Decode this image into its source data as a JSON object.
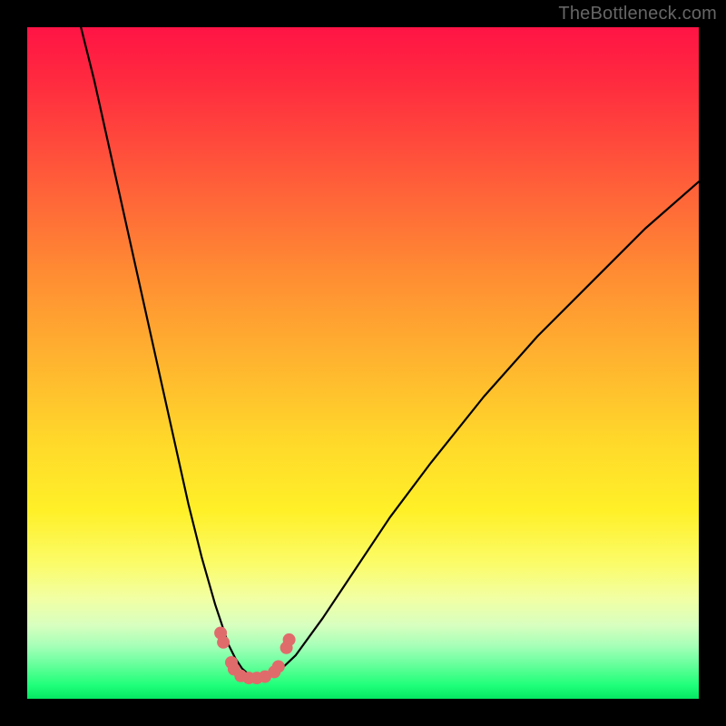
{
  "watermark": "TheBottleneck.com",
  "chart_data": {
    "type": "line",
    "title": "",
    "xlabel": "",
    "ylabel": "",
    "xlim": [
      0,
      100
    ],
    "ylim": [
      0,
      100
    ],
    "grid": false,
    "legend": false,
    "series": [
      {
        "name": "bottleneck-curve",
        "x": [
          8,
          10,
          12,
          14,
          16,
          18,
          20,
          22,
          24,
          26,
          28,
          30,
          31,
          32,
          33,
          34,
          35,
          36,
          38,
          40,
          44,
          48,
          54,
          60,
          68,
          76,
          84,
          92,
          100
        ],
        "y": [
          100,
          92,
          83,
          74,
          65,
          56,
          47,
          38,
          29,
          21,
          14,
          8,
          6,
          4.5,
          3.6,
          3.2,
          3.2,
          3.5,
          4.6,
          6.5,
          12,
          18,
          27,
          35,
          45,
          54,
          62,
          70,
          77
        ]
      }
    ],
    "markers": [
      {
        "x": 28.8,
        "y": 9.8
      },
      {
        "x": 29.2,
        "y": 8.4
      },
      {
        "x": 30.4,
        "y": 5.4
      },
      {
        "x": 30.8,
        "y": 4.4
      },
      {
        "x": 31.8,
        "y": 3.4
      },
      {
        "x": 33.0,
        "y": 3.1
      },
      {
        "x": 34.2,
        "y": 3.1
      },
      {
        "x": 35.4,
        "y": 3.3
      },
      {
        "x": 36.8,
        "y": 4.0
      },
      {
        "x": 37.4,
        "y": 4.8
      },
      {
        "x": 38.6,
        "y": 7.6
      },
      {
        "x": 39.0,
        "y": 8.8
      }
    ],
    "background_gradient": {
      "direction": "vertical",
      "stops": [
        {
          "pos": 0.0,
          "color": "#ff1445"
        },
        {
          "pos": 0.5,
          "color": "#ffb52f"
        },
        {
          "pos": 0.78,
          "color": "#fbfc6a"
        },
        {
          "pos": 1.0,
          "color": "#05e662"
        }
      ]
    }
  }
}
